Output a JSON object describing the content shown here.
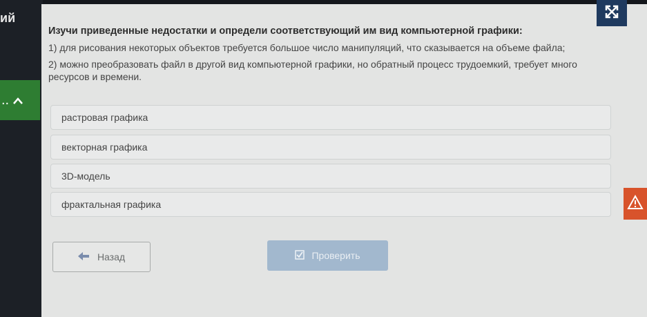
{
  "sidebar": {
    "partial_label": "ий",
    "collapse_dots": "..",
    "collapse_chevron": "^"
  },
  "question": {
    "title": "Изучи приведенные недостатки и определи соответствующий им вид компьютерной графики:",
    "line1": "1) для рисования некоторых объектов требуется большое число манипуляций, что сказывается на объеме файла;",
    "line2": "2) можно преобразовать файл в другой вид компьютерной графики, но обратный процесс трудоемкий, требует много ресурсов и времени."
  },
  "options": [
    {
      "label": "растровая графика"
    },
    {
      "label": "векторная графика"
    },
    {
      "label": "3D-модель"
    },
    {
      "label": "фрактальная графика"
    }
  ],
  "buttons": {
    "back_label": "Назад",
    "check_label": "Проверить"
  },
  "icons": {
    "expand": "expand-icon",
    "warning": "warning-icon",
    "back_arrow": "arrow-left-icon",
    "check": "checkbox-icon"
  },
  "colors": {
    "expand_bg": "#1f3a5f",
    "warning_bg": "#d8532b",
    "check_bg": "#a2b8ce",
    "sidebar_active": "#2e7d32"
  }
}
